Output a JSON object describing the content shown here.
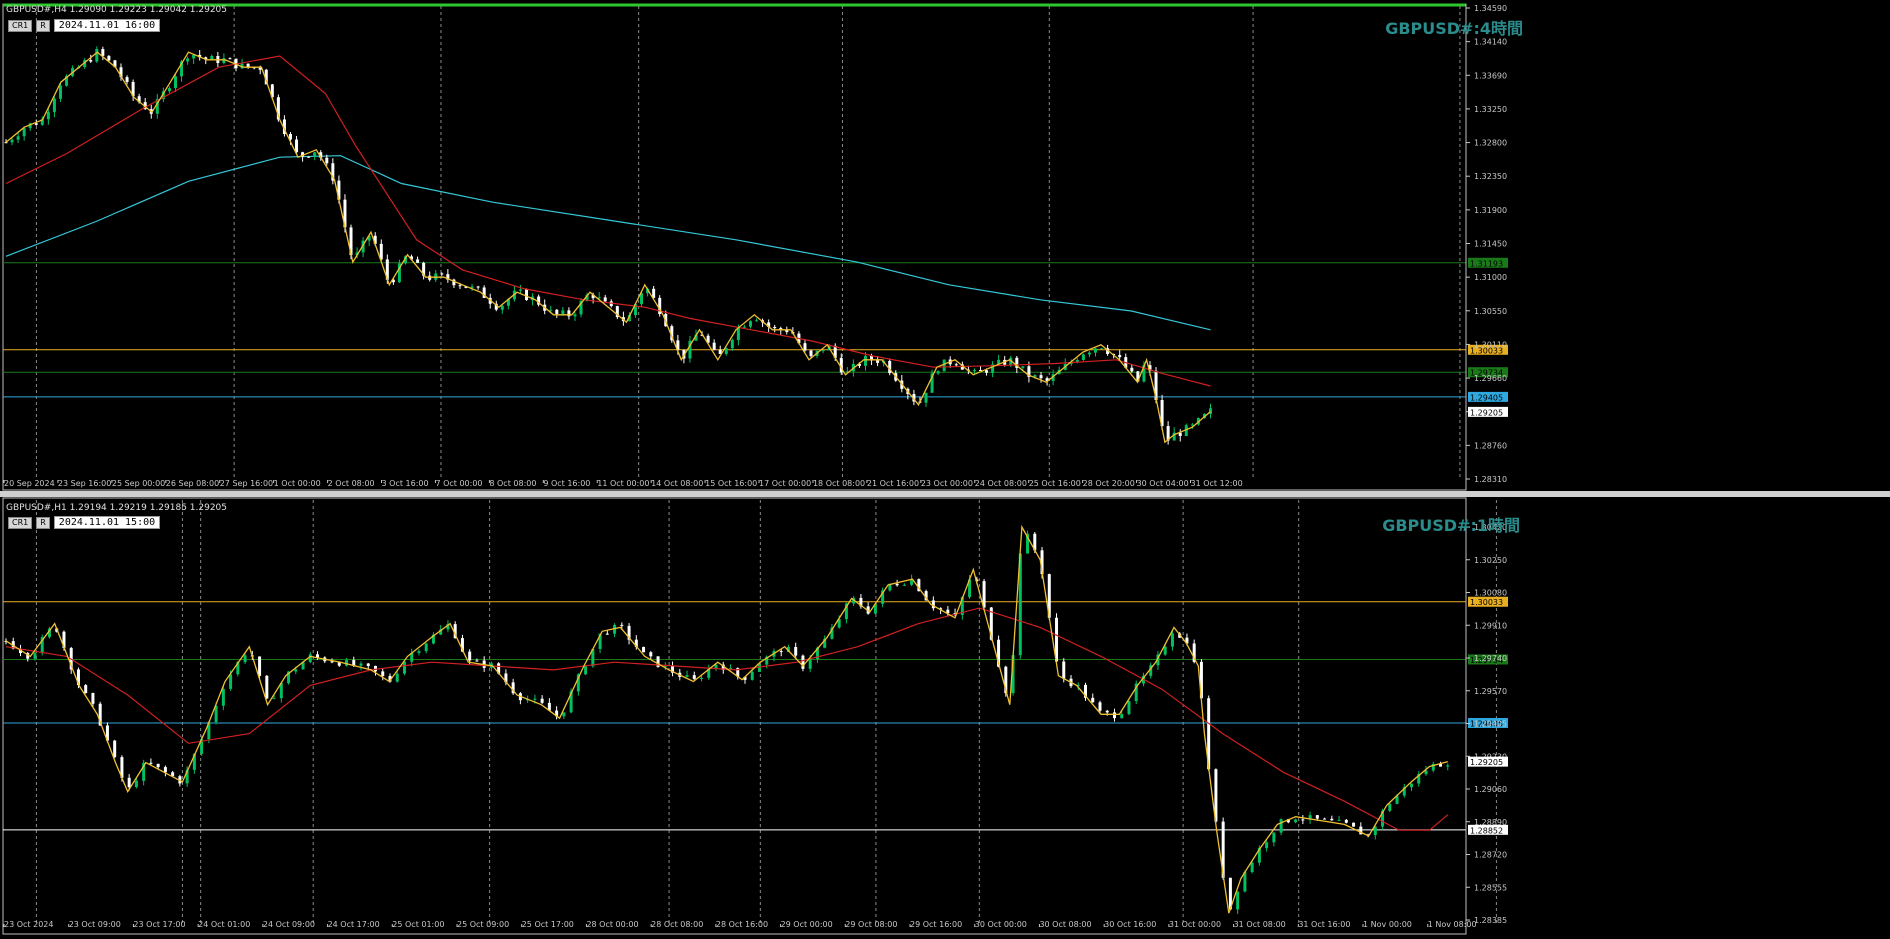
{
  "colors": {
    "bull": "#00c060",
    "bear": "#ffffff",
    "ma_fast": "#d02020",
    "ma_slow": "#35c8d8",
    "zigzag": "#f0c030",
    "grid": "#8a8a8a",
    "axis": "#c8c8c8"
  },
  "panels": [
    {
      "symbol_line": "GBPUSD#,H4  1.29090 1.29223 1.29042 1.29205",
      "cr_label": "CR1",
      "r_label": "R",
      "time_box": "2024.11.01 16:00",
      "title": "GBPUSD#:4時間",
      "chart_data": {
        "type": "candlestick",
        "timeframe": "H4",
        "bars_shown": 200,
        "ylim": [
          1.2831,
          1.3459
        ],
        "y_ticks": [
          "1.34590",
          "1.34140",
          "1.33690",
          "1.33250",
          "1.32800",
          "1.32350",
          "1.31900",
          "1.31450",
          "1.31000",
          "1.30550",
          "1.30110",
          "1.29660",
          "1.29210",
          "1.28760",
          "1.28310"
        ],
        "x_ticks": [
          "20 Sep 2024",
          "23 Sep 16:00",
          "25 Sep 00:00",
          "26 Sep 08:00",
          "27 Sep 16:00",
          "1 Oct 00:00",
          "2 Oct 08:00",
          "3 Oct 16:00",
          "7 Oct 00:00",
          "8 Oct 08:00",
          "9 Oct 16:00",
          "11 Oct 00:00",
          "14 Oct 08:00",
          "15 Oct 16:00",
          "17 Oct 00:00",
          "18 Oct 08:00",
          "21 Oct 16:00",
          "23 Oct 00:00",
          "24 Oct 08:00",
          "25 Oct 16:00",
          "28 Oct 20:00",
          "30 Oct 04:00",
          "31 Oct 12:00"
        ],
        "hlines": [
          {
            "value": 1.31193,
            "label": "1.31193",
            "color": "#1a7a1a"
          },
          {
            "value": 1.30033,
            "label": "1.30033",
            "color": "#e8b020"
          },
          {
            "value": 1.29734,
            "label": "1.29734",
            "color": "#1a7a1a"
          },
          {
            "value": 1.29405,
            "label": "1.29405",
            "color": "#2fa8e0"
          }
        ],
        "last_price": {
          "value": 1.29205,
          "label": "1.29205"
        },
        "close_path": [
          [
            0,
            1.328
          ],
          [
            6,
            1.33
          ],
          [
            12,
            1.331
          ],
          [
            18,
            1.336
          ],
          [
            24,
            1.338
          ],
          [
            30,
            1.34
          ],
          [
            36,
            1.338
          ],
          [
            42,
            1.334
          ],
          [
            48,
            1.332
          ],
          [
            54,
            1.336
          ],
          [
            60,
            1.34
          ],
          [
            66,
            1.339
          ],
          [
            72,
            1.339
          ],
          [
            78,
            1.338
          ],
          [
            84,
            1.338
          ],
          [
            90,
            1.331
          ],
          [
            96,
            1.326
          ],
          [
            102,
            1.327
          ],
          [
            108,
            1.323
          ],
          [
            114,
            1.312
          ],
          [
            120,
            1.316
          ],
          [
            126,
            1.309
          ],
          [
            132,
            1.313
          ],
          [
            138,
            1.31
          ],
          [
            144,
            1.31
          ],
          [
            150,
            1.309
          ],
          [
            156,
            1.308
          ],
          [
            162,
            1.306
          ],
          [
            168,
            1.308
          ],
          [
            174,
            1.307
          ],
          [
            180,
            1.305
          ],
          [
            186,
            1.305
          ],
          [
            192,
            1.308
          ],
          [
            198,
            1.306
          ],
          [
            204,
            1.304
          ],
          [
            210,
            1.309
          ],
          [
            216,
            1.305
          ],
          [
            222,
            1.299
          ],
          [
            228,
            1.303
          ],
          [
            234,
            1.299
          ],
          [
            240,
            1.303
          ],
          [
            246,
            1.305
          ],
          [
            252,
            1.303
          ],
          [
            258,
            1.303
          ],
          [
            264,
            1.299
          ],
          [
            270,
            1.301
          ],
          [
            276,
            1.297
          ],
          [
            282,
            1.299
          ],
          [
            288,
            1.299
          ],
          [
            294,
            1.296
          ],
          [
            300,
            1.293
          ],
          [
            306,
            1.298
          ],
          [
            312,
            1.299
          ],
          [
            318,
            1.297
          ],
          [
            324,
            1.298
          ],
          [
            330,
            1.299
          ],
          [
            336,
            1.297
          ],
          [
            342,
            1.296
          ],
          [
            348,
            1.298
          ],
          [
            354,
            1.3
          ],
          [
            360,
            1.301
          ],
          [
            366,
            1.299
          ],
          [
            372,
            1.296
          ],
          [
            375,
            1.299
          ],
          [
            378,
            1.294
          ],
          [
            381,
            1.288
          ],
          [
            384,
            1.289
          ],
          [
            390,
            1.29
          ],
          [
            396,
            1.2921
          ]
        ],
        "ma_fast": [
          [
            0,
            1.3225
          ],
          [
            20,
            1.3265
          ],
          [
            45,
            1.3325
          ],
          [
            70,
            1.338
          ],
          [
            90,
            1.3395
          ],
          [
            105,
            1.3345
          ],
          [
            115,
            1.3275
          ],
          [
            135,
            1.315
          ],
          [
            150,
            1.311
          ],
          [
            170,
            1.3085
          ],
          [
            190,
            1.307
          ],
          [
            210,
            1.306
          ],
          [
            225,
            1.3045
          ],
          [
            245,
            1.303
          ],
          [
            265,
            1.3015
          ],
          [
            285,
            1.2995
          ],
          [
            305,
            1.298
          ],
          [
            325,
            1.2982
          ],
          [
            345,
            1.2985
          ],
          [
            365,
            1.299
          ],
          [
            380,
            1.2972
          ],
          [
            396,
            1.2955
          ]
        ],
        "ma_slow": [
          [
            0,
            1.3128
          ],
          [
            30,
            1.3175
          ],
          [
            60,
            1.3228
          ],
          [
            90,
            1.326
          ],
          [
            110,
            1.3262
          ],
          [
            130,
            1.3225
          ],
          [
            160,
            1.32
          ],
          [
            200,
            1.3175
          ],
          [
            240,
            1.315
          ],
          [
            280,
            1.312
          ],
          [
            310,
            1.309
          ],
          [
            340,
            1.307
          ],
          [
            370,
            1.3055
          ],
          [
            396,
            1.303
          ]
        ],
        "vgrid": [
          10,
          75,
          143,
          208,
          275,
          343,
          410,
          478
        ]
      }
    },
    {
      "symbol_line": "GBPUSD#,H1  1.29194 1.29219 1.29185 1.29205",
      "cr_label": "CR1",
      "r_label": "R",
      "time_box": "2024.11.01 15:00",
      "title": "GBPUSD#:1時間",
      "chart_data": {
        "type": "candlestick",
        "timeframe": "H1",
        "bars_shown": 200,
        "ylim": [
          1.28385,
          1.3042
        ],
        "y_ticks": [
          "1.30420",
          "1.30250",
          "1.30080",
          "1.29910",
          "1.29740",
          "1.29570",
          "1.29405",
          "1.29230",
          "1.29060",
          "1.28890",
          "1.28720",
          "1.28555",
          "1.28385"
        ],
        "x_ticks": [
          "23 Oct 2024",
          "23 Oct 09:00",
          "23 Oct 17:00",
          "24 Oct 01:00",
          "24 Oct 09:00",
          "24 Oct 17:00",
          "25 Oct 01:00",
          "25 Oct 09:00",
          "25 Oct 17:00",
          "28 Oct 00:00",
          "28 Oct 08:00",
          "28 Oct 16:00",
          "29 Oct 00:00",
          "29 Oct 08:00",
          "29 Oct 16:00",
          "30 Oct 00:00",
          "30 Oct 08:00",
          "30 Oct 16:00",
          "31 Oct 00:00",
          "31 Oct 08:00",
          "31 Oct 16:00",
          "1 Nov 00:00",
          "1 Nov 08:00"
        ],
        "hlines": [
          {
            "value": 1.30033,
            "label": "1.30033",
            "color": "#e8b020"
          },
          {
            "value": 1.29734,
            "label": "1.29734",
            "color": "#1a7a1a"
          },
          {
            "value": 1.29405,
            "label": "1.29405",
            "color": "#2fa8e0"
          },
          {
            "value": 1.28852,
            "label": "1.28852",
            "color": "#ffffff"
          }
        ],
        "last_price": {
          "value": 1.29205,
          "label": "1.29205"
        },
        "close_path": [
          [
            0,
            1.2983
          ],
          [
            8,
            1.2975
          ],
          [
            16,
            1.2992
          ],
          [
            24,
            1.296
          ],
          [
            30,
            1.2945
          ],
          [
            36,
            1.292
          ],
          [
            40,
            1.2905
          ],
          [
            46,
            1.292
          ],
          [
            52,
            1.2915
          ],
          [
            58,
            1.291
          ],
          [
            66,
            1.2938
          ],
          [
            72,
            1.2962
          ],
          [
            80,
            1.298
          ],
          [
            86,
            1.295
          ],
          [
            92,
            1.2965
          ],
          [
            100,
            1.2975
          ],
          [
            110,
            1.2972
          ],
          [
            120,
            1.2968
          ],
          [
            126,
            1.2962
          ],
          [
            132,
            1.2975
          ],
          [
            140,
            1.2985
          ],
          [
            146,
            1.2992
          ],
          [
            152,
            1.2972
          ],
          [
            160,
            1.297
          ],
          [
            168,
            1.2955
          ],
          [
            176,
            1.295
          ],
          [
            182,
            1.2943
          ],
          [
            190,
            1.297
          ],
          [
            196,
            1.2988
          ],
          [
            202,
            1.299
          ],
          [
            210,
            1.2975
          ],
          [
            218,
            1.2968
          ],
          [
            226,
            1.2962
          ],
          [
            234,
            1.2972
          ],
          [
            242,
            1.2963
          ],
          [
            248,
            1.2972
          ],
          [
            256,
            1.298
          ],
          [
            262,
            1.297
          ],
          [
            270,
            1.2985
          ],
          [
            278,
            1.3005
          ],
          [
            284,
            1.2998
          ],
          [
            290,
            1.3012
          ],
          [
            298,
            1.3015
          ],
          [
            304,
            1.3002
          ],
          [
            312,
            1.2995
          ],
          [
            318,
            1.302
          ],
          [
            324,
            1.2985
          ],
          [
            330,
            1.295
          ],
          [
            334,
            1.3042
          ],
          [
            340,
            1.3025
          ],
          [
            346,
            1.2965
          ],
          [
            352,
            1.296
          ],
          [
            360,
            1.2945
          ],
          [
            366,
            1.2945
          ],
          [
            372,
            1.296
          ],
          [
            378,
            1.2972
          ],
          [
            384,
            1.299
          ],
          [
            388,
            1.2982
          ],
          [
            392,
            1.297
          ],
          [
            394,
            1.2935
          ],
          [
            398,
            1.2885
          ],
          [
            402,
            1.2842
          ],
          [
            406,
            1.286
          ],
          [
            412,
            1.2875
          ],
          [
            418,
            1.2888
          ],
          [
            424,
            1.2892
          ],
          [
            432,
            1.289
          ],
          [
            440,
            1.2888
          ],
          [
            448,
            1.2882
          ],
          [
            454,
            1.2898
          ],
          [
            462,
            1.291
          ],
          [
            468,
            1.2918
          ],
          [
            474,
            1.29205
          ]
        ],
        "ma_fast": [
          [
            0,
            1.298
          ],
          [
            20,
            1.2975
          ],
          [
            40,
            1.2955
          ],
          [
            60,
            1.293
          ],
          [
            80,
            1.2935
          ],
          [
            100,
            1.296
          ],
          [
            120,
            1.2968
          ],
          [
            140,
            1.2972
          ],
          [
            160,
            1.297
          ],
          [
            180,
            1.2968
          ],
          [
            200,
            1.2972
          ],
          [
            220,
            1.297
          ],
          [
            240,
            1.2968
          ],
          [
            260,
            1.2972
          ],
          [
            280,
            1.298
          ],
          [
            300,
            1.2992
          ],
          [
            320,
            1.3
          ],
          [
            340,
            1.299
          ],
          [
            360,
            1.2975
          ],
          [
            380,
            1.2958
          ],
          [
            400,
            1.2935
          ],
          [
            420,
            1.2915
          ],
          [
            440,
            1.29
          ],
          [
            458,
            1.2885
          ],
          [
            468,
            1.2885
          ],
          [
            474,
            1.2893
          ]
        ],
        "vgrid": [
          10,
          58,
          64,
          101,
          159,
          218,
          248,
          286,
          320,
          387,
          425,
          490
        ]
      }
    }
  ]
}
